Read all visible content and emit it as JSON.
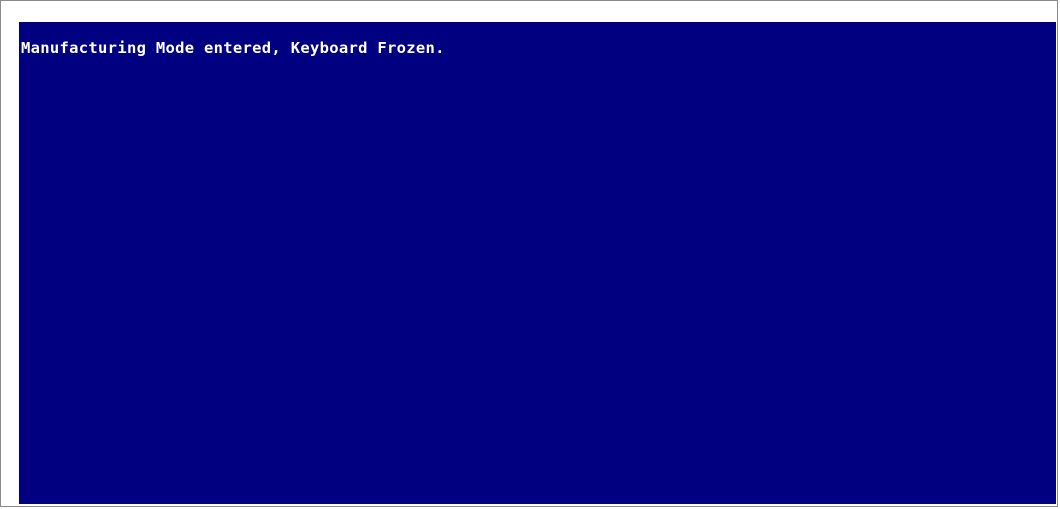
{
  "screen": {
    "background_color": "#000080",
    "text_color": "#ffffff",
    "message": "Manufacturing Mode entered, Keyboard Frozen."
  }
}
